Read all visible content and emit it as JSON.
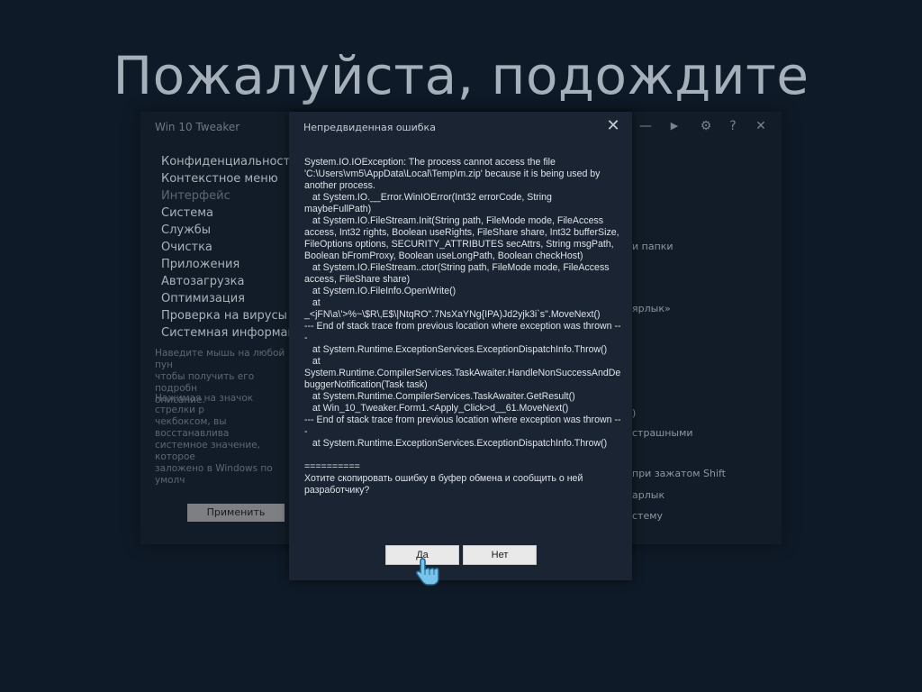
{
  "overlay": {
    "wait_text": "Пожалуйста, подождите"
  },
  "app": {
    "title": "Win 10 Tweaker",
    "window_controls": [
      "minimize-icon",
      "play-icon",
      "gear-icon",
      "help-icon",
      "close-icon"
    ],
    "window_control_glyphs": [
      "—",
      "▶",
      "⚙",
      "?",
      "✕"
    ],
    "nav": [
      {
        "label": "Конфиденциальность",
        "dim": false
      },
      {
        "label": "Контекстное меню",
        "dim": false
      },
      {
        "label": "Интерфейс",
        "dim": true
      },
      {
        "label": "Система",
        "dim": false
      },
      {
        "label": "Службы",
        "dim": false
      },
      {
        "label": "Очистка",
        "dim": false
      },
      {
        "label": "Приложения",
        "dim": false
      },
      {
        "label": "Автозагрузка",
        "dim": false
      },
      {
        "label": "Оптимизация",
        "dim": false
      },
      {
        "label": "Проверка на вирусы",
        "dim": false
      },
      {
        "label": "Системная информац",
        "dim": false
      }
    ],
    "hint_1": "Наведите мышь на любой пун\nчтобы получить его подробн\nописание.",
    "hint_2": "Нажимая на значок стрелки р\nчекбоксом, вы восстанавлива\nсистемное значение, которое\nзаложено в Windows по умолч",
    "apply_label": "Применить",
    "right_fragments": [
      "и папки",
      "ярлык»",
      ")",
      "страшными",
      "при зажатом Shift",
      "арлык",
      "стему"
    ]
  },
  "dialog": {
    "title": "Непредвиденная ошибка",
    "message": "System.IO.IOException: The process cannot access the file 'C:\\Users\\vm5\\AppData\\Local\\Temp\\m.zip' because it is being used by another process.\n   at System.IO.__Error.WinIOError(Int32 errorCode, String maybeFullPath)\n   at System.IO.FileStream.Init(String path, FileMode mode, FileAccess access, Int32 rights, Boolean useRights, FileShare share, Int32 bufferSize, FileOptions options, SECURITY_ATTRIBUTES secAttrs, String msgPath, Boolean bFromProxy, Boolean useLongPath, Boolean checkHost)\n   at System.IO.FileStream..ctor(String path, FileMode mode, FileAccess access, FileShare share)\n   at System.IO.FileInfo.OpenWrite()\n   at\n_<jFN\\a\\'>%~\\$R\\,E$\\|NtqRO\".7NsXaYNg{IPA)Jd2yjk3i`s\".MoveNext()\n--- End of stack trace from previous location where exception was thrown ---\n   at System.Runtime.ExceptionServices.ExceptionDispatchInfo.Throw()\n   at\nSystem.Runtime.CompilerServices.TaskAwaiter.HandleNonSuccessAndDebuggerNotification(Task task)\n   at System.Runtime.CompilerServices.TaskAwaiter.GetResult()\n   at Win_10_Tweaker.Form1.<Apply_Click>d__61.MoveNext()\n--- End of stack trace from previous location where exception was thrown ---\n   at System.Runtime.ExceptionServices.ExceptionDispatchInfo.Throw()\n\n==========\nХотите скопировать ошибку в буфер обмена и сообщить о ней разработчику?",
    "yes_label": "Да",
    "no_label": "Нет",
    "close_glyph": "✕"
  }
}
